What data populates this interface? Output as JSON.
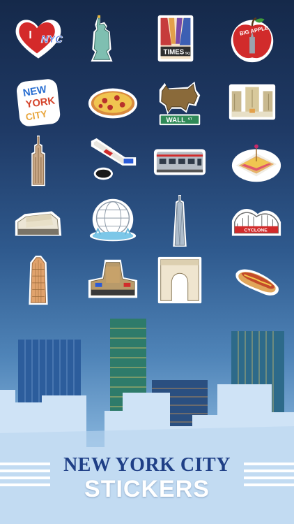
{
  "title": {
    "line1": "NEW YORK CITY",
    "line2": "STICKERS"
  },
  "stickers": [
    {
      "icon": "i-love-nyc-heart-icon",
      "text": "I",
      "text2": "NYC"
    },
    {
      "icon": "statue-of-liberty-icon"
    },
    {
      "icon": "times-square-icon",
      "text": "TIMES",
      "text2": "SQ"
    },
    {
      "icon": "big-apple-icon",
      "text": "BIG APPLE"
    },
    {
      "icon": "new-york-city-text-icon",
      "text": "NEW",
      "text2": "YORK",
      "text3": "CITY"
    },
    {
      "icon": "pizza-icon"
    },
    {
      "icon": "wall-street-bull-icon",
      "text": "WALL",
      "text2": "ST"
    },
    {
      "icon": "rockefeller-center-icon"
    },
    {
      "icon": "empire-state-building-icon"
    },
    {
      "icon": "hockey-stick-puck-icon"
    },
    {
      "icon": "subway-train-icon"
    },
    {
      "icon": "sandwich-icon"
    },
    {
      "icon": "guggenheim-museum-icon"
    },
    {
      "icon": "unisphere-icon"
    },
    {
      "icon": "one-world-trade-center-icon"
    },
    {
      "icon": "coney-island-cyclone-icon",
      "text": "CYCLONE"
    },
    {
      "icon": "flatiron-building-icon"
    },
    {
      "icon": "madison-square-garden-icon"
    },
    {
      "icon": "washington-square-arch-icon"
    },
    {
      "icon": "hot-dog-icon"
    }
  ],
  "colors": {
    "background_top": "#15294a",
    "background_bottom": "#a9cdea",
    "title_blue": "#1f3f86",
    "heart_red": "#d42a2a",
    "nyc_blue": "#2a5bd8"
  }
}
